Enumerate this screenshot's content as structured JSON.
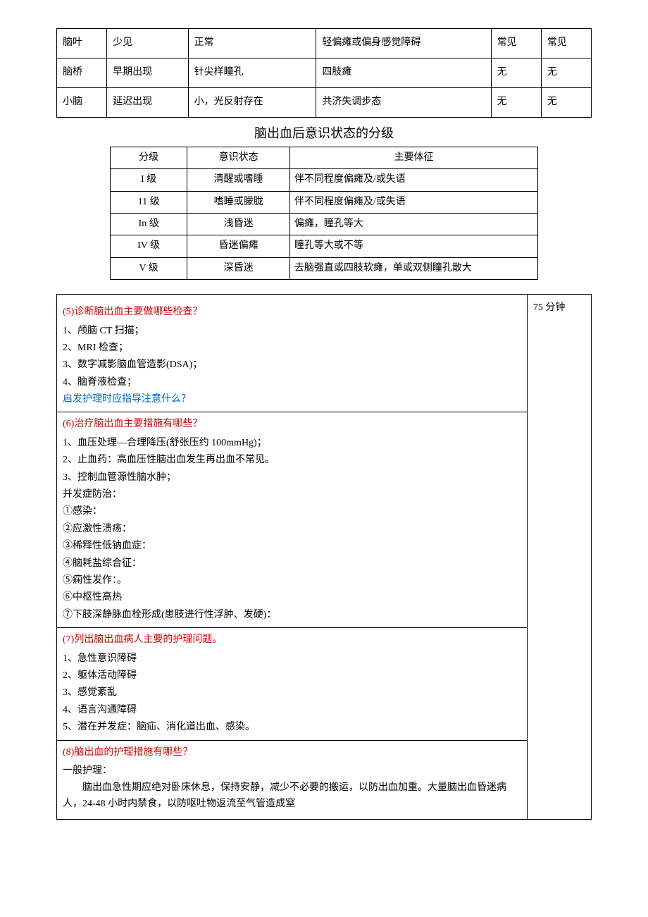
{
  "table1": {
    "rows": [
      {
        "a": "脑叶",
        "b": "少见",
        "c": "正常",
        "d": "轻偏瘫或偏身感觉障碍",
        "e": "常见",
        "f": "常见"
      },
      {
        "a": "脑桥",
        "b": "早期出现",
        "c": "针尖样瞳孔",
        "d": "四肢瘫",
        "e": "无",
        "f": "无"
      },
      {
        "a": "小脑",
        "b": "延迟出现",
        "c": "小，光反射存在",
        "d": "共济失调步态",
        "e": "无",
        "f": "无"
      }
    ]
  },
  "table2": {
    "title": "脑出血后意识状态的分级",
    "headers": {
      "a": "分级",
      "b": "意识状态",
      "c": "主要体征"
    },
    "rows": [
      {
        "a": "I 级",
        "b": "清醒或嗜睡",
        "c": "伴不同程度偏瘫及/或失语"
      },
      {
        "a": "11 级",
        "b": "嗜睡或朦胧",
        "c": "伴不同程度偏瘫及/或失语"
      },
      {
        "a": "In 级",
        "b": "浅昏迷",
        "c": "偏瘫，瞳孔等大"
      },
      {
        "a": "IV 级",
        "b": "昏迷偏瘫",
        "c": "瞳孔等大或不等"
      },
      {
        "a": "V 级",
        "b": "深昏迷",
        "c": "去脑强直或四肢软瘫，单或双侧瞳孔散大"
      }
    ]
  },
  "section5": {
    "title": "(5)诊断脑出血主要做哪些检查？",
    "items": [
      "1、颅脑 CT 扫描；",
      "2、MRI 检查；",
      "3、数字减影脑血管造影(DSA)；",
      "4、脑脊液检查；"
    ],
    "note": "启发护理时应指导注意什么？"
  },
  "section6": {
    "title": "(6)治疗脑出血主要措施有哪些？",
    "items": [
      "1、血压处理—合理降压(舒张压约 100mmHg)；",
      "2、止血药：高血压性脑出血发生再出血不常见。",
      "3、控制血管源性脑水肿；",
      "并发症防治：",
      "①感染：",
      "②应激性溃疡：",
      "③稀释性低钠血症：",
      "④脑耗盐综合征：",
      "⑤痫性发作：。",
      "⑥中枢性高热",
      "⑦下肢深静脉血栓形成(患肢进行性浮肿、发硬)："
    ]
  },
  "section7": {
    "title": "(7)列出脑出血病人主要的护理问题。",
    "items": [
      "1、急性意识障碍",
      "2、躯体活动障碍",
      "3、感觉紊乱",
      "4、语言沟通障碍",
      "5、潜在并发症：脑疝、消化道出血、感染。"
    ]
  },
  "section8": {
    "title": "(8)脑出血的护理措施有哪些？",
    "sub": "一般护理：",
    "para": "脑出血急性期应绝对卧床休息，保持安静，减少不必要的搬运，以防出血加重。大量脑出血昏迷病人，24-48 小时内禁食，以防呕吐物返流至气管造成窒"
  },
  "time": "75 分钟"
}
